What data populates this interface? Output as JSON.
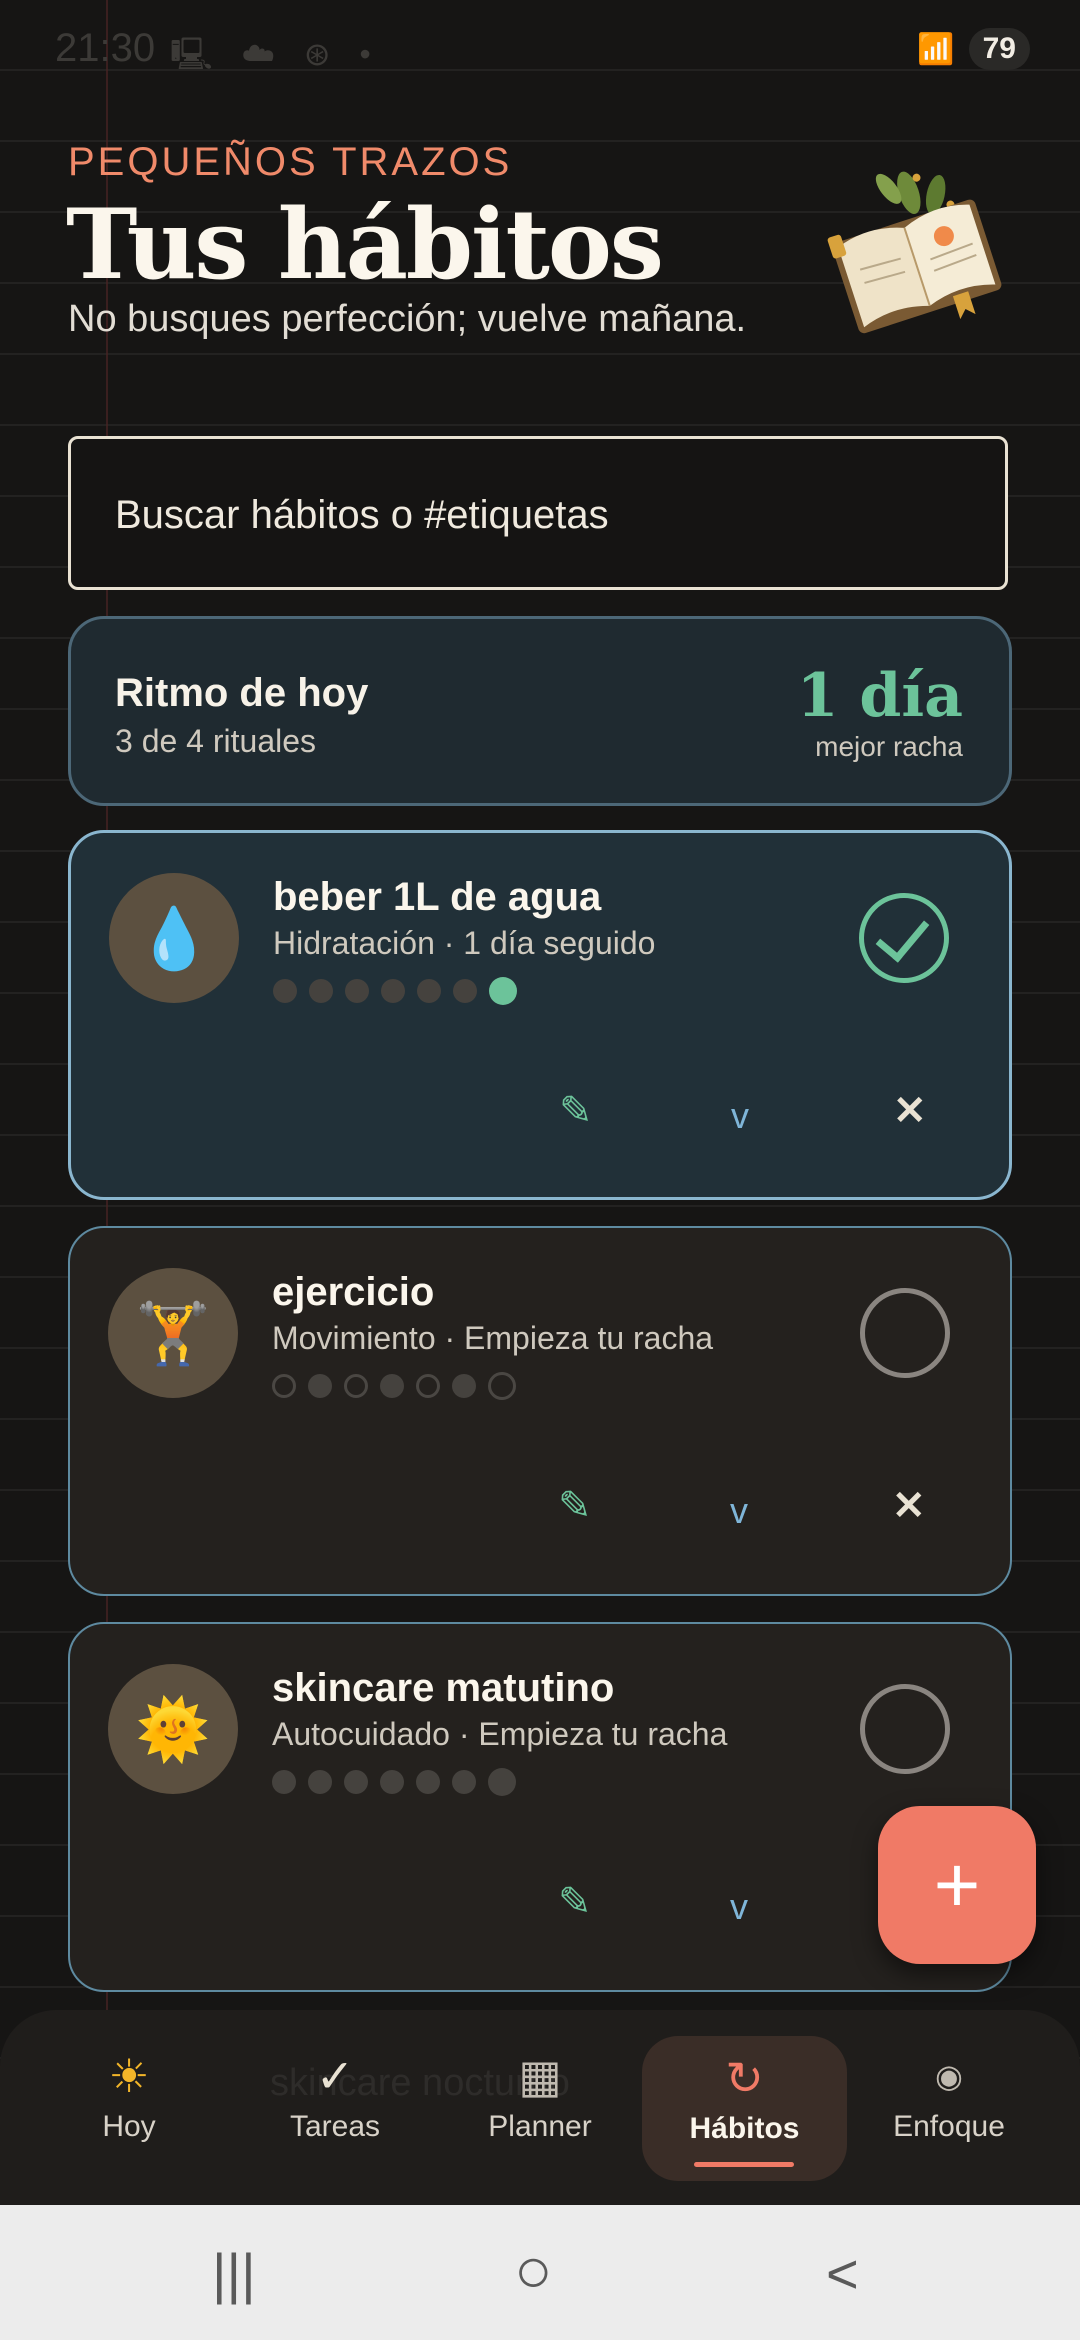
{
  "status_bar": {
    "time": "21:30",
    "notif_icons": "🖳 ☁ ⊛ •",
    "signal": "📶",
    "battery": "79"
  },
  "header": {
    "eyebrow": "PEQUEÑOS TRAZOS",
    "title": "Tus hábitos",
    "subtitle": "No busques perfección; vuelve mañana."
  },
  "search": {
    "placeholder": "Buscar hábitos o #etiquetas",
    "value": ""
  },
  "rhythm": {
    "title": "Ritmo de hoy",
    "subtitle": "3 de 4 rituales",
    "streak": "1 día",
    "streak_label": "mejor racha"
  },
  "habits": [
    {
      "emoji": "💧",
      "name": "beber 1L de agua",
      "subtitle": "Hidratación · 1 día seguido",
      "done": true
    },
    {
      "emoji": "🏋️",
      "name": "ejercicio",
      "subtitle": "Movimiento · Empieza tu racha",
      "done": false
    },
    {
      "emoji": "🌞",
      "name": "skincare matutino",
      "subtitle": "Autocuidado · Empieza tu racha",
      "done": false
    }
  ],
  "actions": {
    "edit_icon": "✎",
    "expand_icon": "v",
    "remove_icon": "✕"
  },
  "fab": {
    "icon": "+"
  },
  "nav": {
    "ghost_text": "skincare nocturno",
    "items": [
      {
        "icon": "☀",
        "label": "Hoy"
      },
      {
        "icon": "✓",
        "label": "Tareas"
      },
      {
        "icon": "▦",
        "label": "Planner"
      },
      {
        "icon": "↻",
        "label": "Hábitos"
      },
      {
        "icon": "◉",
        "label": "Enfoque"
      }
    ],
    "active": "Hábitos"
  },
  "system_nav": {
    "recents": "|||",
    "home": "○",
    "back": "<"
  },
  "colors": {
    "accent": "#f07a66",
    "success": "#6cc39a",
    "card_border": "#8ab6cf",
    "background": "#161514"
  }
}
